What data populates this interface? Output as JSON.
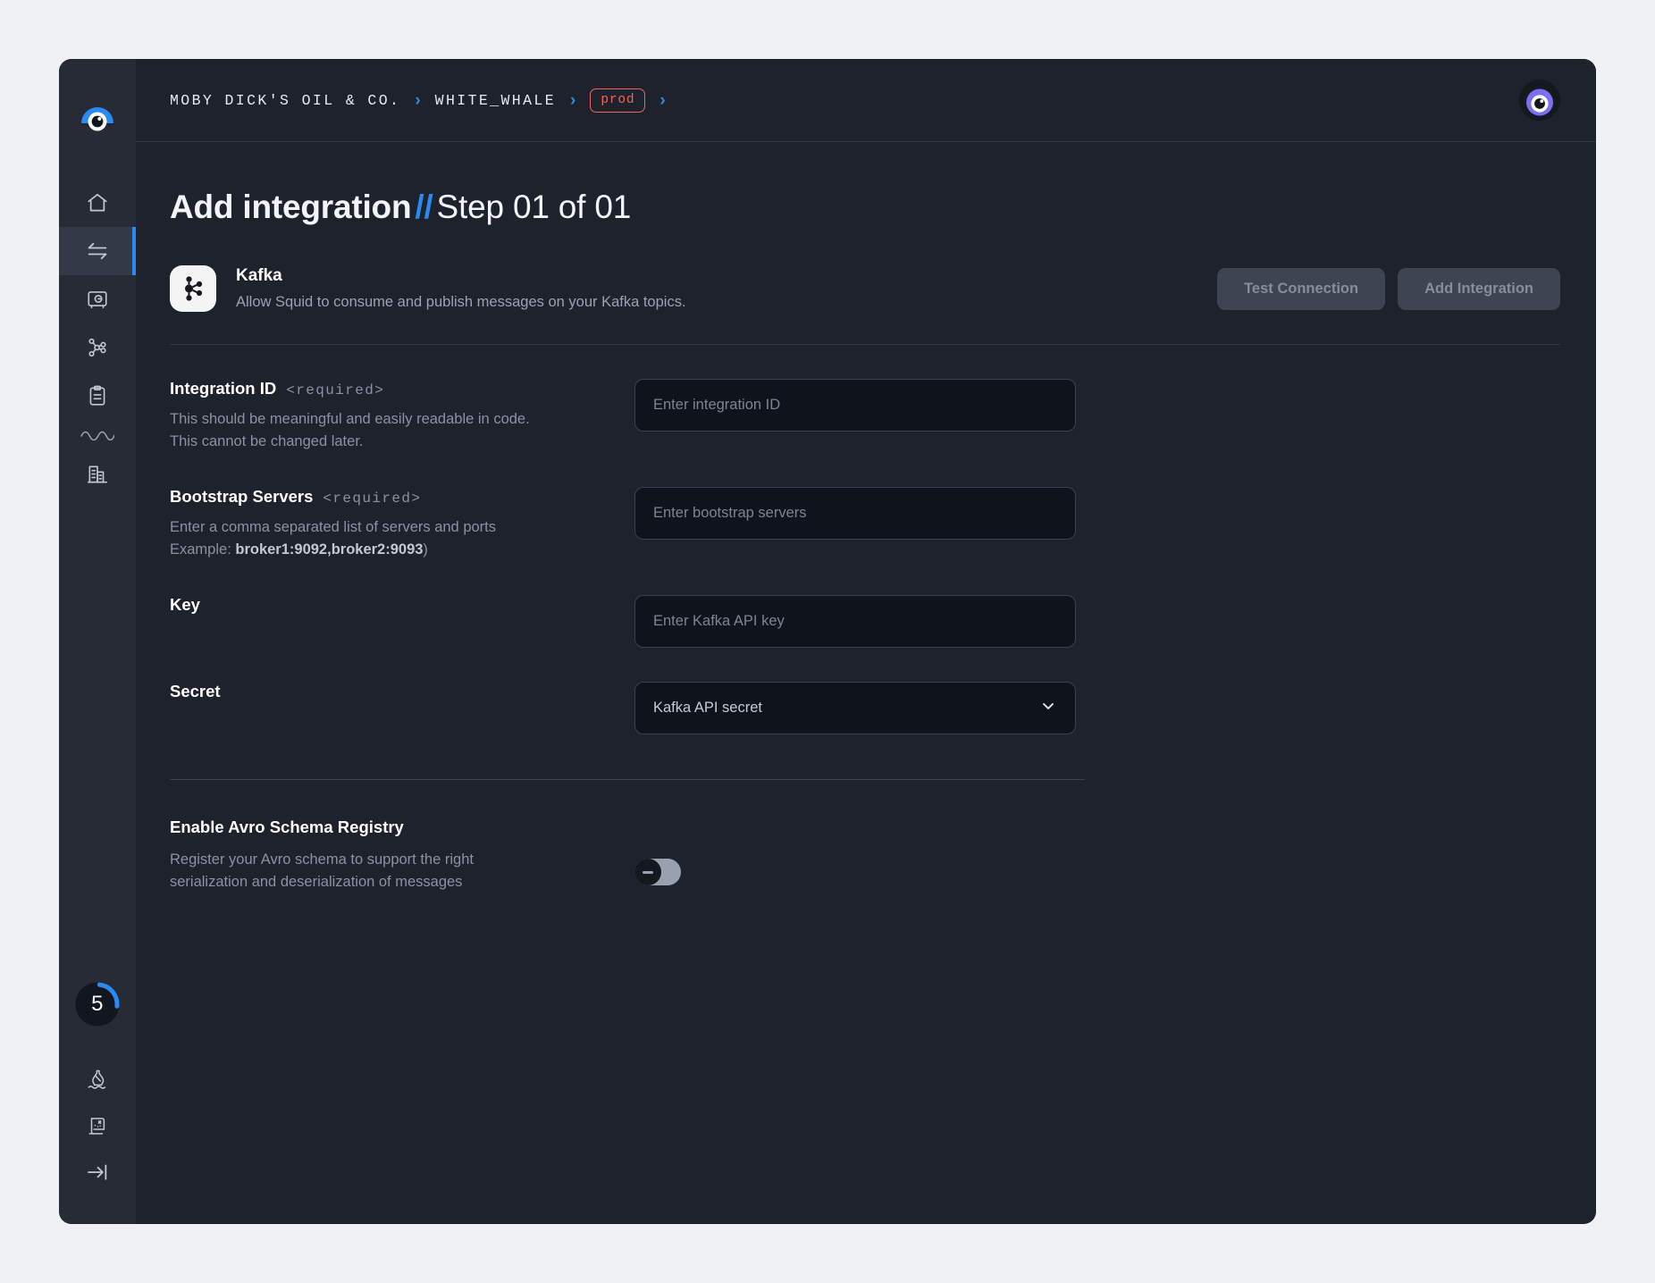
{
  "breadcrumb": {
    "items": [
      {
        "label": "MOBY DICK'S OIL & CO.",
        "type": "text"
      },
      {
        "label": "WHITE_WHALE",
        "type": "text"
      }
    ],
    "env_badge": "prod",
    "separator": "›"
  },
  "sidebar": {
    "logo_name": "squid-logo",
    "items": [
      {
        "name": "home",
        "icon": "home-icon",
        "active": false
      },
      {
        "name": "integrations",
        "icon": "exchange-arrows-icon",
        "active": true
      },
      {
        "name": "secrets",
        "icon": "safe-icon",
        "active": false
      },
      {
        "name": "schema",
        "icon": "node-graph-icon",
        "active": false
      },
      {
        "name": "logs",
        "icon": "clipboard-icon",
        "active": false
      },
      {
        "name": "organization",
        "icon": "buildings-icon",
        "active": false
      }
    ],
    "progress_badge": "5",
    "progress_percent": 25,
    "bottom_items": [
      {
        "name": "message-bottle",
        "icon": "message-in-bottle-icon"
      },
      {
        "name": "treasure-map",
        "icon": "scroll-map-icon"
      },
      {
        "name": "collapse-sidebar",
        "icon": "collapse-arrow-icon"
      }
    ]
  },
  "header": {
    "avatar_name": "user-avatar"
  },
  "page": {
    "title_bold": "Add integration",
    "title_slash": "//",
    "title_light": "Step 01 of 01"
  },
  "integration": {
    "logo_name": "kafka-logo",
    "name": "Kafka",
    "description": "Allow Squid to consume and publish messages on your Kafka topics.",
    "test_connection_label": "Test Connection",
    "add_integration_label": "Add Integration"
  },
  "fields": {
    "integration_id": {
      "label": "Integration ID",
      "required_tag": "<required>",
      "help_line_1": "This should be meaningful and easily readable in code.",
      "help_line_2": "This cannot be changed later.",
      "placeholder": "Enter integration ID",
      "value": ""
    },
    "bootstrap_servers": {
      "label": "Bootstrap Servers",
      "required_tag": "<required>",
      "help_line_1": "Enter a comma separated list of servers and ports",
      "help_prefix": "Example:",
      "help_example": "broker1:9092,broker2:9093",
      "help_suffix": ")",
      "placeholder": "Enter bootstrap servers",
      "value": ""
    },
    "key": {
      "label": "Key",
      "placeholder": "Enter Kafka API key",
      "value": ""
    },
    "secret": {
      "label": "Secret",
      "selected": "Kafka API secret"
    }
  },
  "avro": {
    "title": "Enable Avro Schema Registry",
    "desc_line_1": "Register your Avro schema to support the right",
    "desc_line_2": "serialization and deserialization of messages",
    "enabled": false
  },
  "colors": {
    "page_background": "#eff1f5",
    "sidebar": "#262b36",
    "main": "#1d222c",
    "accent_blue": "#2b8aef",
    "env_red": "#f0675a",
    "input_background": "#0f131b"
  }
}
